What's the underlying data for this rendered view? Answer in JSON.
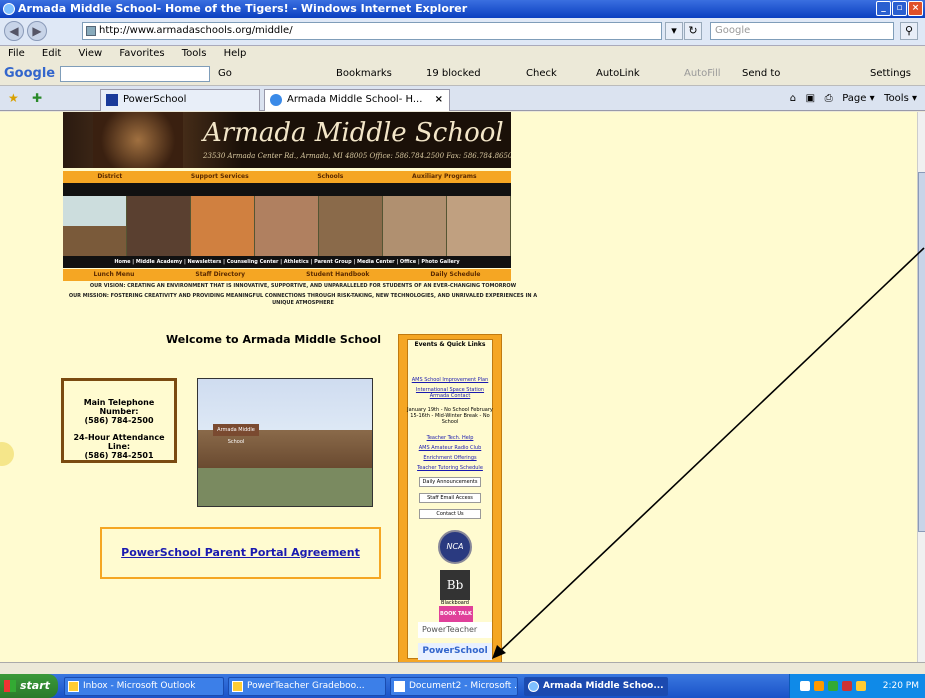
{
  "window": {
    "title": "Armada Middle School- Home of the Tigers! - Windows Internet Explorer"
  },
  "address": {
    "url": "http://www.armadaschools.org/middle/",
    "search_placeholder": "Google"
  },
  "menu": {
    "items": [
      "File",
      "Edit",
      "View",
      "Favorites",
      "Tools",
      "Help"
    ]
  },
  "google_toolbar": {
    "logo": "Google",
    "go": "Go",
    "bookmarks": "Bookmarks",
    "blocked": "19 blocked",
    "check": "Check",
    "autolink": "AutoLink",
    "autofill": "AutoFill",
    "sendto": "Send to",
    "settings": "Settings"
  },
  "tabs": [
    {
      "label": "PowerSchool"
    },
    {
      "label": "Armada Middle School- H..."
    }
  ],
  "tab_tools": {
    "page": "Page",
    "tools": "Tools"
  },
  "page": {
    "banner_name": "Armada Middle School",
    "banner_address": "23530 Armada Center Rd., Armada, MI 48005     Office: 586.784.2500     Fax: 586.784.8650",
    "nav1": [
      "District",
      "Support Services",
      "Schools",
      "Auxiliary Programs"
    ],
    "nav2": "Home | Middle Academy | Newsletters | Counseling Center | Athletics | Parent Group | Media Center | Office | Photo Gallery",
    "nav3": [
      "Lunch Menu",
      "Staff Directory",
      "Student Handbook",
      "Daily Schedule"
    ],
    "vision": "OUR VISION: CREATING AN ENVIRONMENT THAT IS INNOVATIVE, SUPPORTIVE, AND UNPARALLELED FOR STUDENTS OF AN EVER-CHANGING TOMORROW",
    "mission": "OUR MISSION: FOSTERING CREATIVITY AND PROVIDING MEANINGFUL CONNECTIONS THROUGH RISK-TAKING, NEW TECHNOLOGIES, AND UNRIVALED EXPERIENCES IN A UNIQUE ATMOSPHERE",
    "welcome": "Welcome to Armada Middle School",
    "phone_label": "Main Telephone Number:",
    "phone_number": "(586) 784-2500",
    "attendance_label": "24-Hour Attendance Line:",
    "attendance_number": "(586) 784-2501",
    "school_sign": "Armada Middle School",
    "portal_link": "PowerSchool Parent Portal Agreement"
  },
  "sidebar": {
    "title": "Events & Quick Links",
    "links1": [
      "AMS School Improvement Plan",
      "International Space Station Armada Contact"
    ],
    "dates": "January 19th - No School February 15-16th - Mid-Winter Break - No School",
    "links2": [
      "Teacher Tech. Help",
      "AMS Amateur Radio Club",
      "Enrichment Offerings",
      "Teacher Tutoring Schedule"
    ],
    "buttons": [
      "Daily Announcements",
      "Staff Email Access",
      "Contact Us"
    ],
    "nca": "NCA",
    "bb": "Bb",
    "bb_text": "Blackboard",
    "booktalk": "BOOK TALK",
    "powerteacher": "PowerTeacher",
    "powerschool": "PowerSchool"
  },
  "taskbar": {
    "start": "start",
    "tasks": [
      "Inbox - Microsoft Outlook",
      "PowerTeacher Gradeboo...",
      "Document2 - Microsoft ...",
      "Armada Middle Schoo..."
    ],
    "time": "2:20 PM"
  }
}
